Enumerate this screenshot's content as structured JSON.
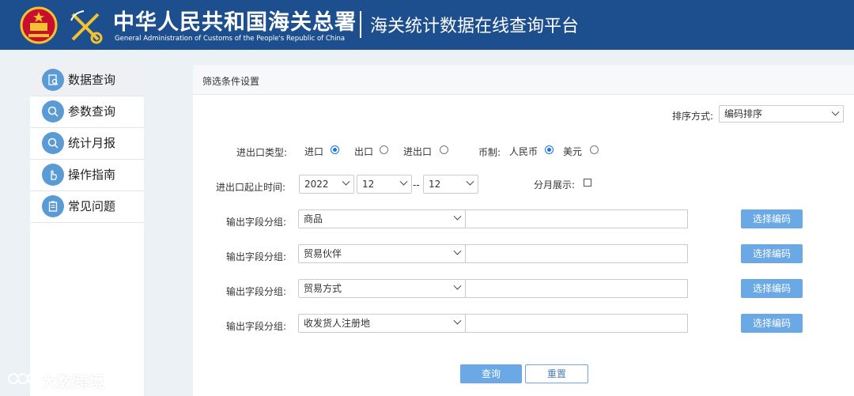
{
  "header": {
    "title_cn": "中华人民共和国海关总署",
    "title_en": "General Administration of Customs of the People's Republic of China",
    "platform": "海关统计数据在线查询平台"
  },
  "sidebar": {
    "items": [
      {
        "label": "数据查询",
        "icon": "document-search-icon",
        "active": true
      },
      {
        "label": "参数查询",
        "icon": "search-icon",
        "active": false
      },
      {
        "label": "统计月报",
        "icon": "search-icon",
        "active": false
      },
      {
        "label": "操作指南",
        "icon": "hand-pointer-icon",
        "active": false
      },
      {
        "label": "常见问题",
        "icon": "clipboard-icon",
        "active": false
      }
    ]
  },
  "panel": {
    "title": "筛选条件设置",
    "sort": {
      "label": "排序方式:",
      "value": "编码排序"
    },
    "trade_type": {
      "label": "进出口类型:",
      "options": [
        "进口",
        "出口",
        "进出口"
      ],
      "selected": "进口"
    },
    "currency": {
      "label": "币制:",
      "options": [
        "人民币",
        "美元"
      ],
      "selected": "人民币"
    },
    "period": {
      "label": "进出口起止时间:",
      "year": "2022",
      "start_month": "12",
      "separator": "--",
      "end_month": "12"
    },
    "monthly": {
      "label": "分月展示:",
      "checked": false
    },
    "field_groups": [
      {
        "label": "输出字段分组:",
        "value": "商品",
        "button": "选择编码"
      },
      {
        "label": "输出字段分组:",
        "value": "贸易伙伴",
        "button": "选择编码"
      },
      {
        "label": "输出字段分组:",
        "value": "贸易方式",
        "button": "选择编码"
      },
      {
        "label": "输出字段分组:",
        "value": "收发货人注册地",
        "button": "选择编码"
      }
    ],
    "query_button": "查询",
    "reset_button": "重置"
  },
  "watermark": "大数跨境",
  "colors": {
    "header_bg": "#1d4f8e",
    "accent": "#6aa9e6",
    "page_bg": "#ecf1f6"
  }
}
